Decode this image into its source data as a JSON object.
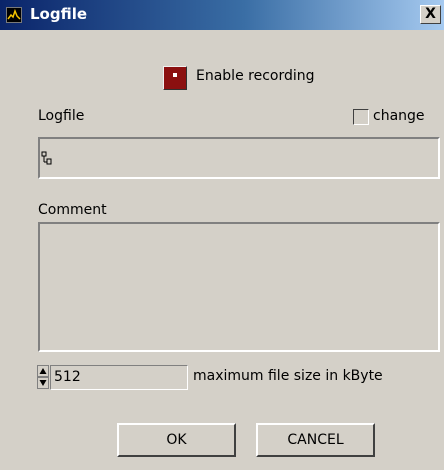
{
  "window": {
    "title": "Logfile",
    "close_label": "X",
    "app_icon": "waveform-icon"
  },
  "recording": {
    "enable_label": "Enable recording",
    "button_color": "#8b1010"
  },
  "logfile": {
    "label": "Logfile",
    "change_label": "change",
    "change_checked": false,
    "path_value": ""
  },
  "comment": {
    "label": "Comment",
    "value": ""
  },
  "size": {
    "value": "512",
    "label": "maximum file size in kByte"
  },
  "buttons": {
    "ok": "OK",
    "cancel": "CANCEL"
  },
  "colors": {
    "dialog_bg": "#d4d0c8",
    "titlebar_start": "#0a246a",
    "titlebar_end": "#a6caf0"
  }
}
